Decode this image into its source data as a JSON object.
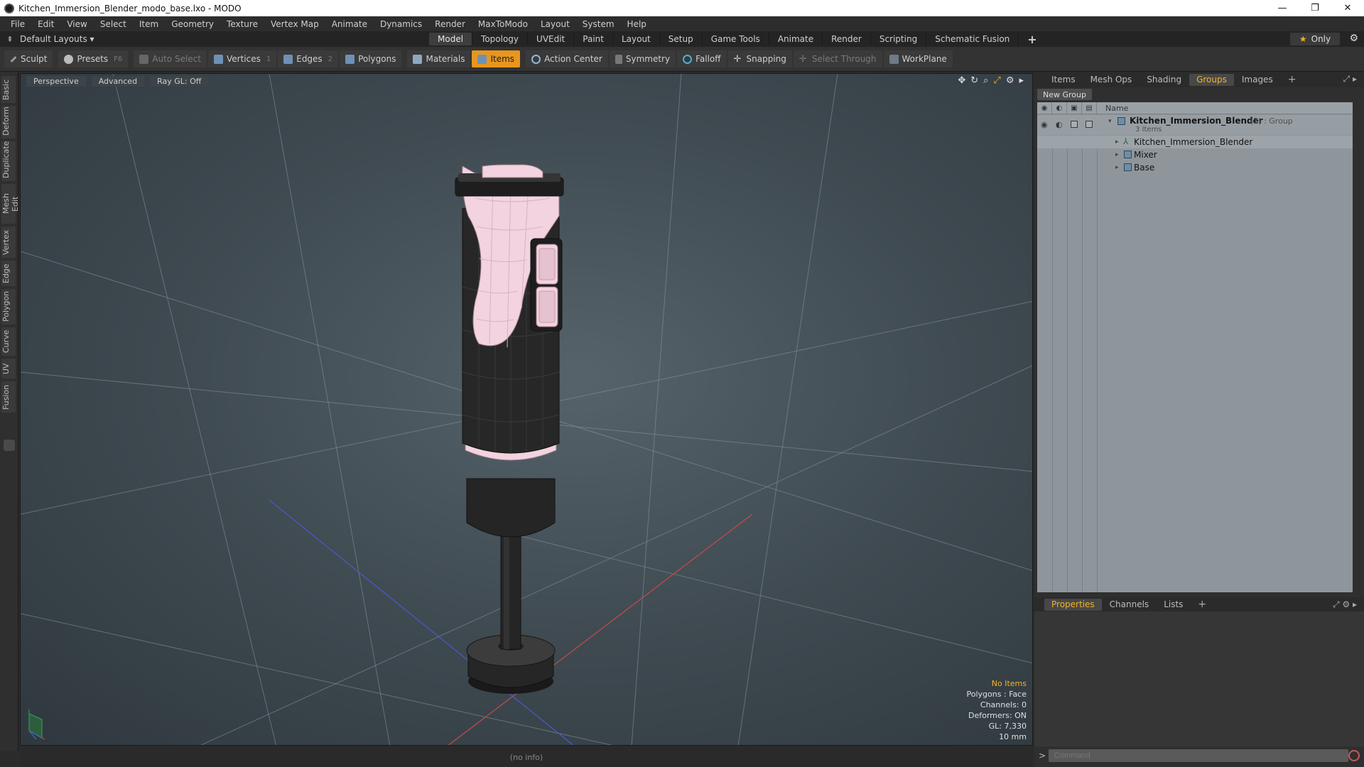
{
  "window": {
    "title": "Kitchen_Immersion_Blender_modo_base.lxo - MODO",
    "minimize": "—",
    "restore": "❐",
    "close": "✕"
  },
  "menu": [
    "File",
    "Edit",
    "View",
    "Select",
    "Item",
    "Geometry",
    "Texture",
    "Vertex Map",
    "Animate",
    "Dynamics",
    "Render",
    "MaxToModo",
    "Layout",
    "System",
    "Help"
  ],
  "layoutbar": {
    "layouts_label": "Default Layouts ▾",
    "tabs": [
      "Model",
      "Topology",
      "UVEdit",
      "Paint",
      "Layout",
      "Setup",
      "Game Tools",
      "Animate",
      "Render",
      "Scripting",
      "Schematic Fusion"
    ],
    "active_tab": "Model",
    "plus": "+",
    "only_label": "Only"
  },
  "toolbar": {
    "sculpt": "Sculpt",
    "presets": "Presets",
    "presets_key": "F6",
    "auto_select": "Auto Select",
    "vertices": "Vertices",
    "vertices_count": "1",
    "edges": "Edges",
    "edges_count": "2",
    "polygons": "Polygons",
    "materials": "Materials",
    "items": "Items",
    "action_center": "Action Center",
    "symmetry": "Symmetry",
    "falloff": "Falloff",
    "snapping": "Snapping",
    "select_through": "Select Through",
    "workplane": "WorkPlane"
  },
  "left_tabs": [
    "Basic",
    "Deform",
    "Duplicate",
    "Mesh Edit",
    "Vertex",
    "Edge",
    "Polygon",
    "Curve",
    "UV",
    "Fusion"
  ],
  "viewport": {
    "perspective": "Perspective",
    "advanced": "Advanced",
    "raygl": "Ray GL: Off",
    "info": {
      "no_items": "No Items",
      "polygons": "Polygons : Face",
      "channels": "Channels: 0",
      "deformers": "Deformers: ON",
      "gl": "GL: 7,330",
      "scale": "10 mm"
    }
  },
  "status": {
    "text": "(no info)"
  },
  "right_panel": {
    "tabs": [
      "Items",
      "Mesh Ops",
      "Shading",
      "Groups",
      "Images"
    ],
    "active_tab": "Groups",
    "new_group": "New Group",
    "name_header": "Name",
    "group": {
      "name": "Kitchen_Immersion_Blender",
      "suffix": "(2) : Group",
      "count": "3 Items",
      "children": [
        "Kitchen_Immersion_Blender",
        "Mixer",
        "Base"
      ]
    },
    "lower_tabs": [
      "Properties",
      "Channels",
      "Lists"
    ],
    "lower_active": "Properties",
    "command_placeholder": "Command"
  },
  "colors": {
    "accent": "#e8961e",
    "active_text": "#f0b428",
    "handle_pink": "#f2d3df",
    "body_dark": "#2a2a2a"
  }
}
